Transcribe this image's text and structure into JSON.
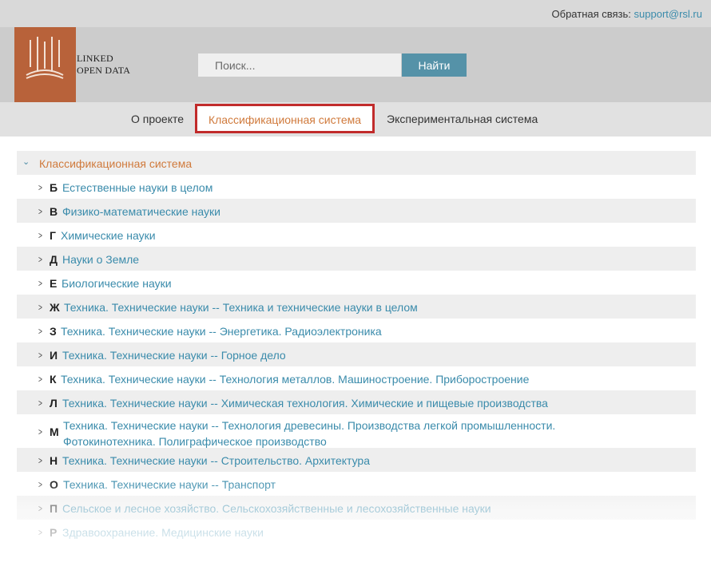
{
  "topbar": {
    "feedback_label": "Обратная связь:",
    "feedback_email": "support@rsl.ru"
  },
  "brand": {
    "line1": "LINKED",
    "line2": "OPEN DATA"
  },
  "search": {
    "placeholder": "Поиск...",
    "button_label": "Найти"
  },
  "nav": {
    "items": [
      "О проекте",
      "Классификационная система",
      "Экспериментальная система"
    ],
    "active_index": 1
  },
  "tree": {
    "root_label": "Классификационная система",
    "items": [
      {
        "code": "Б",
        "name": "Естественные науки в целом"
      },
      {
        "code": "В",
        "name": "Физико-математические науки"
      },
      {
        "code": "Г",
        "name": "Химические науки"
      },
      {
        "code": "Д",
        "name": "Науки о Земле"
      },
      {
        "code": "Е",
        "name": "Биологические науки"
      },
      {
        "code": "Ж",
        "name": "Техника. Технические науки -- Техника и технические науки в целом"
      },
      {
        "code": "З",
        "name": "Техника. Технические науки -- Энергетика. Радиоэлектроника"
      },
      {
        "code": "И",
        "name": "Техника. Технические науки -- Горное дело"
      },
      {
        "code": "К",
        "name": "Техника. Технические науки -- Технология металлов. Машиностроение. Приборостроение"
      },
      {
        "code": "Л",
        "name": "Техника. Технические науки -- Химическая технология. Химические и пищевые производства"
      },
      {
        "code": "М",
        "name": "Техника. Технические науки -- Технология древесины. Производства легкой промышленности. Фотокинотехника. Полиграфическое производство"
      },
      {
        "code": "Н",
        "name": "Техника. Технические науки -- Строительство. Архитектура"
      },
      {
        "code": "О",
        "name": "Техника. Технические науки -- Транспорт"
      },
      {
        "code": "П",
        "name": "Сельское и лесное хозяйство. Сельскохозяйственные и лесохозяйственные науки"
      },
      {
        "code": "Р",
        "name": "Здравоохранение. Медицинские науки"
      }
    ]
  },
  "colors": {
    "accent": "#d07a3c",
    "link": "#3a8bab",
    "button": "#5592a8",
    "highlight_border": "#c12b2b",
    "logo": "#b8623a"
  }
}
